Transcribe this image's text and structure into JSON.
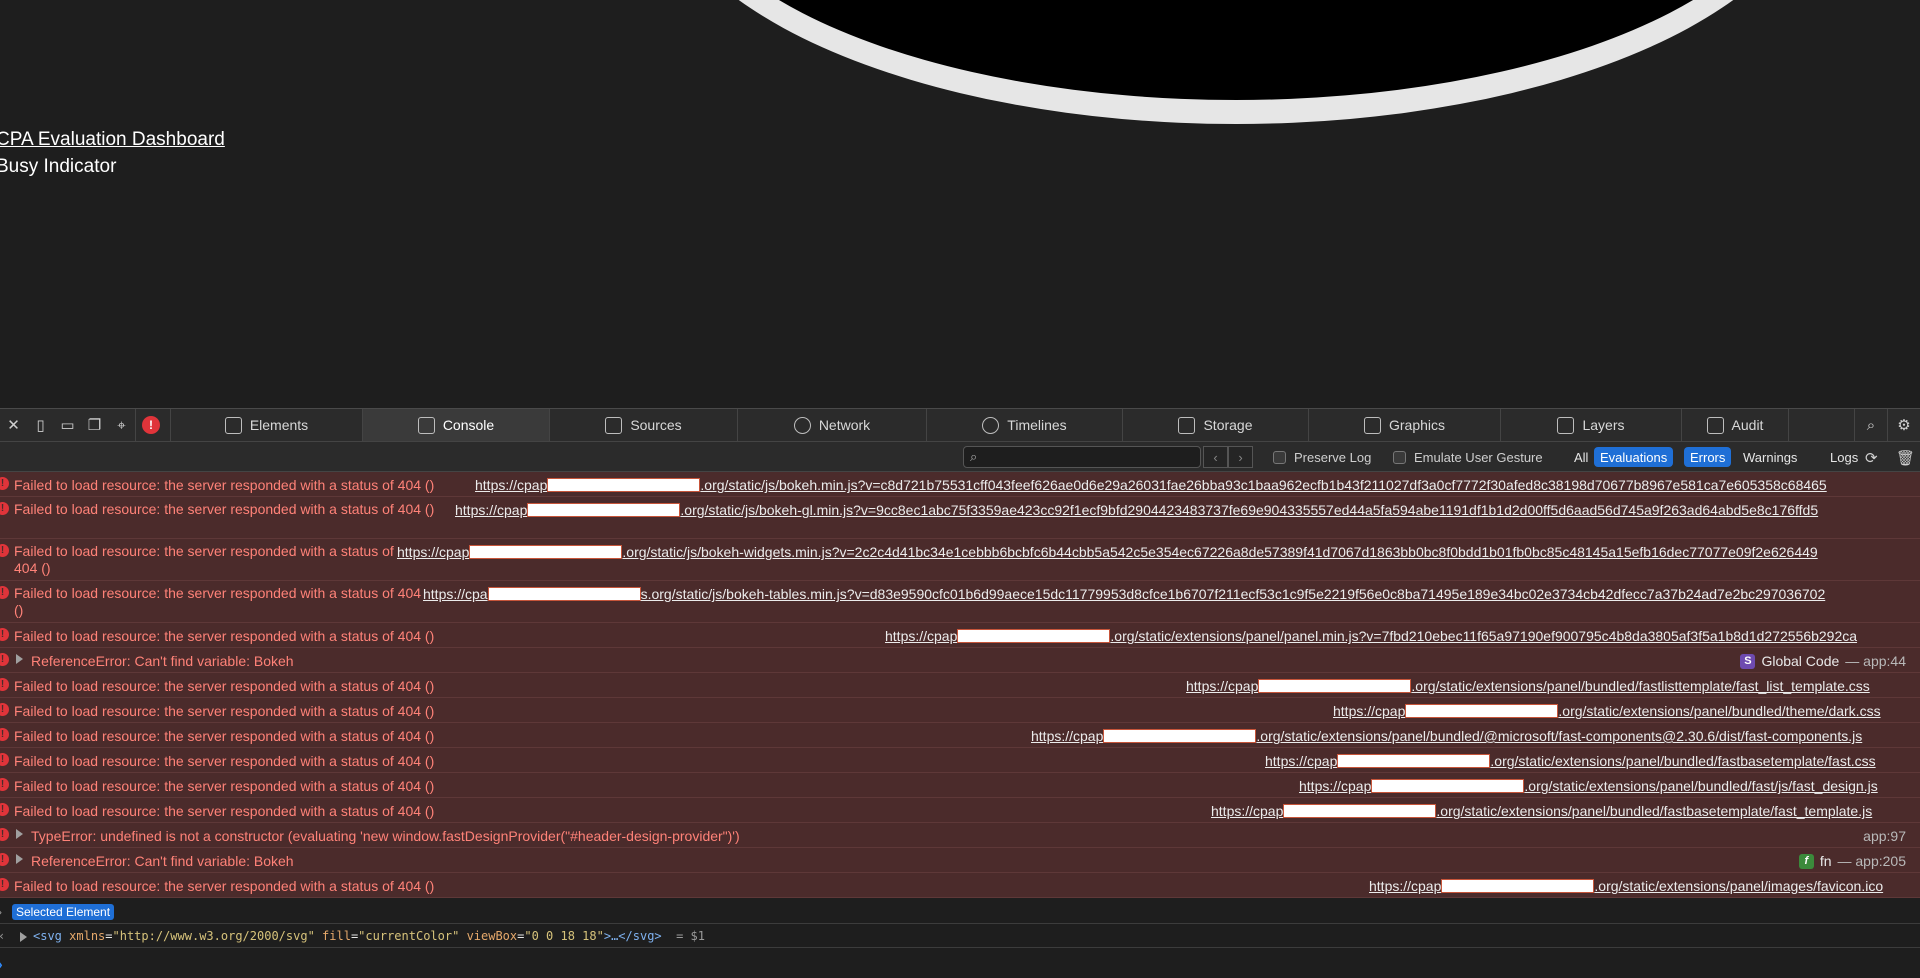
{
  "page": {
    "link_text": "CPA Evaluation Dashboard",
    "busy_text": "Busy Indicator"
  },
  "devtools": {
    "tabs": [
      {
        "label": "Elements",
        "icon": "elements-icon"
      },
      {
        "label": "Console",
        "icon": "console-icon"
      },
      {
        "label": "Sources",
        "icon": "sources-icon"
      },
      {
        "label": "Network",
        "icon": "network-icon"
      },
      {
        "label": "Timelines",
        "icon": "timelines-icon"
      },
      {
        "label": "Storage",
        "icon": "storage-icon"
      },
      {
        "label": "Graphics",
        "icon": "graphics-icon"
      },
      {
        "label": "Layers",
        "icon": "layers-icon"
      },
      {
        "label": "Audit",
        "icon": "audit-icon"
      }
    ],
    "active_tab": "Console",
    "error_badge": "!"
  },
  "filter": {
    "search_placeholder": "",
    "preserve_log": "Preserve Log",
    "emulate_gesture": "Emulate User Gesture",
    "levels": [
      {
        "label": "All",
        "on": false
      },
      {
        "label": "Evaluations",
        "on": true
      },
      {
        "label": "Errors",
        "on": true
      },
      {
        "label": "Warnings",
        "on": false
      },
      {
        "label": "Logs",
        "on": false
      }
    ]
  },
  "console": {
    "err404": "Failed to load resource: the server responded with a status of 404 ()",
    "err404_wrap_a": "Failed to load resource: the server responded with a status of 404 ()",
    "err404_wrap_b": "Failed to load resource: the server responded with a status of 404 ()",
    "err404_wrap_c": "Failed to load resource: the server responded with a status of 404 ()",
    "url_prefix_a": "https://cpap",
    "url_prefix_b": "https://cpa",
    "entries": [
      {
        "url_pre": "https://cpap",
        "url_post": ".org/static/js/bokeh.min.js?v=c8d721b75531cff043feef626ae0d6e29a26031fae26bba93c1baa962ecfb1b43f211027df3a0cf7772f30afed8c38198d70677b8967e581ca7e605358c68465"
      },
      {
        "url_pre": "https://cpap",
        "url_post": ".org/static/js/bokeh-gl.min.js?v=9cc8ec1abc75f3359ae423cc92f1ecf9bfd2904423483737fe69e904335557ed44a5fa594abe1191df1b1d2d00ff5d6aad56d745a9f263ad64abd5e8c176ffd5"
      },
      {
        "url_pre": "https://cpap",
        "url_post": ".org/static/js/bokeh-widgets.min.js?v=2c2c4d41bc34e1cebbb6bcbfc6b44cbb5a542c5e354ec67226a8de57389f41d7067d1863bb0bc8f0bdd1b01fb0bc85c48145a15efb16dec77077e09f2e626449"
      },
      {
        "url_pre": "https://cpa",
        "url_post": "s.org/static/js/bokeh-tables.min.js?v=d83e9590cfc01b6d99aece15dc11779953d8cfce1b6707f211ecf53c1c9f5e2219f56e0c8ba71495e189e34bc02e3734cb42dfecc7a37b24ad7e2bc297036702"
      },
      {
        "url_pre": "https://cpap",
        "url_post": ".org/static/extensions/panel/panel.min.js?v=7fbd210ebec11f65a97190ef900795c4b8da3805af3f5a1b8d1d272556b292ca"
      },
      {
        "msg": "ReferenceError: Can't find variable: Bokeh",
        "src_badge": "S",
        "src_name": "Global Code",
        "src_loc": "— app:44"
      },
      {
        "url_pre": "https://cpap",
        "url_post": ".org/static/extensions/panel/bundled/fastlisttemplate/fast_list_template.css"
      },
      {
        "url_pre": "https://cpap",
        "url_post": ".org/static/extensions/panel/bundled/theme/dark.css"
      },
      {
        "url_pre": "https://cpap",
        "url_post": ".org/static/extensions/panel/bundled/@microsoft/fast-components@2.30.6/dist/fast-components.js"
      },
      {
        "url_pre": "https://cpap",
        "url_post": ".org/static/extensions/panel/bundled/fastbasetemplate/fast.css"
      },
      {
        "url_pre": "https://cpap",
        "url_post": ".org/static/extensions/panel/bundled/fast/js/fast_design.js"
      },
      {
        "url_pre": "https://cpap",
        "url_post": ".org/static/extensions/panel/bundled/fastbasetemplate/fast_template.js"
      },
      {
        "msg": "TypeError: undefined is not a constructor (evaluating 'new window.fastDesignProvider(\"#header-design-provider\")')",
        "src_loc": "app:97"
      },
      {
        "msg": "ReferenceError: Can't find variable: Bokeh",
        "src_badge": "f",
        "src_name": "fn",
        "src_loc": "— app:205"
      },
      {
        "url_pre": "https://cpap",
        "url_post": ".org/static/extensions/panel/images/favicon.ico"
      }
    ]
  },
  "selected": {
    "pill": "Selected Element",
    "code_open": "<svg",
    "attr1_name": "xmlns",
    "attr1_val": "\"http://www.w3.org/2000/svg\"",
    "attr2_name": "fill",
    "attr2_val": "\"currentColor\"",
    "attr3_name": "viewBox",
    "attr3_val": "\"0 0 18 18\"",
    "code_close": ">…</svg>",
    "ref": "= $1"
  },
  "colors": {
    "error_bg": "#4b2b2b",
    "error_text": "#ff8278",
    "accent": "#1f6fd6"
  }
}
